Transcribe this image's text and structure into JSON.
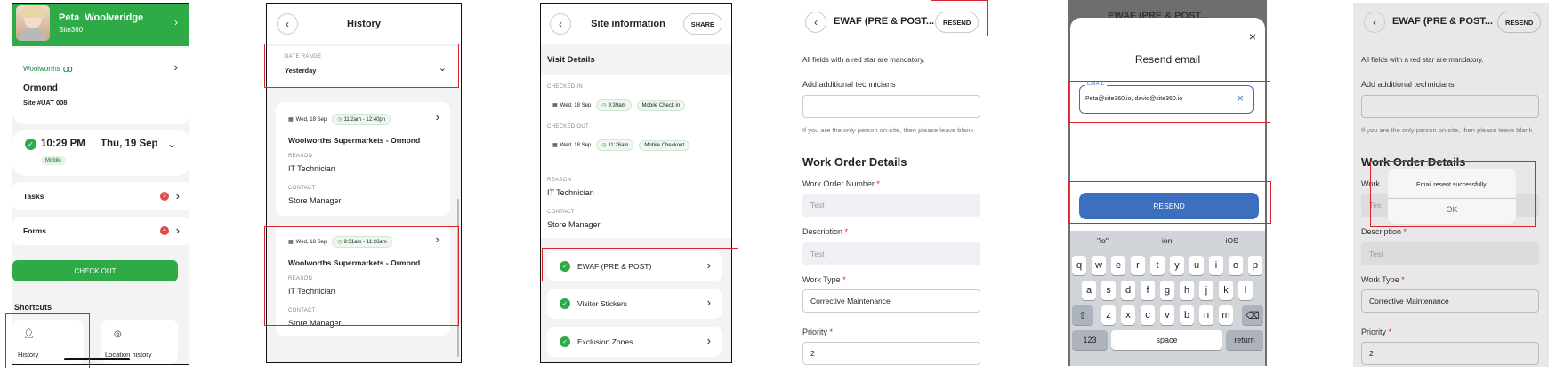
{
  "screen1": {
    "user_name": "Peta  Woolveridge",
    "user_company": "Site360",
    "store_brand": "Woolworths",
    "store_name": "Ormond",
    "store_id": "Site #UAT 008",
    "time": "10:29 PM",
    "date": "Thu, 19 Sep",
    "mode_badge": "Mobile",
    "tasks_label": "Tasks",
    "tasks_count": "3",
    "forms_label": "Forms",
    "forms_count": "4",
    "checkout_label": "CHECK OUT",
    "shortcuts_label": "Shortcuts",
    "history_label": "History",
    "location_history_label": "Location history"
  },
  "screen2": {
    "title": "History",
    "date_range_label": "DATE RANGE",
    "date_range_value": "Yesterday",
    "visits": [
      {
        "date": "Wed, 18 Sep",
        "time": "11:2am - 12:40pn",
        "site": "Woolworths Supermarkets - Ormond",
        "reason_label": "REASON",
        "reason": "IT Technician",
        "contact_label": "CONTACT",
        "contact": "Store Manager"
      },
      {
        "date": "Wed, 18 Sep",
        "time": "9:31am - 11:26am",
        "site": "Woolworths Supermarkets - Ormond",
        "reason_label": "REASON",
        "reason": "IT Technician",
        "contact_label": "CONTACT",
        "contact": "Store Manager"
      }
    ]
  },
  "screen3": {
    "title": "Site information",
    "share_label": "SHARE",
    "section_title": "Visit Details",
    "checked_in_label": "CHECKED IN",
    "checked_in_date": "Wed, 18 Sep",
    "checked_in_time": "9:39am",
    "checked_in_method": "Mobile Check in",
    "checked_out_label": "CHECKED OUT",
    "checked_out_date": "Wed, 18 Sep",
    "checked_out_time": "11:26am",
    "checked_out_method": "Mobile Checkout",
    "reason_label": "REASON",
    "reason": "IT Technician",
    "contact_label": "CONTACT",
    "contact": "Store Manager",
    "forms": [
      "EWAF (PRE & POST)",
      "Visitor Stickers",
      "Exclusion Zones"
    ]
  },
  "screen4": {
    "title": "EWAF (PRE & POST...",
    "resend_label": "RESEND",
    "mandatory_note": "All fields with a red star are mandatory.",
    "add_tech_label": "Add additional technicians",
    "add_tech_hint": "If you are the only person on-site, then please leave blank",
    "section_title": "Work Order Details",
    "won_label": "Work Order Number",
    "won_value": "Test",
    "desc_label": "Description",
    "desc_value": "Test",
    "worktype_label": "Work Type",
    "worktype_value": "Corrective Maintenance",
    "priority_label": "Priority",
    "priority_value": "2",
    "star": "*"
  },
  "screen5": {
    "header_ghost": "EWAF (PRE & POST...",
    "modal_title": "Resend email",
    "email_label": "EMAIL",
    "email_value": "Peta@site360.io, david@site360.io",
    "resend_button": "RESEND",
    "suggestions": [
      "\"io\"",
      "ion",
      "iOS"
    ],
    "row1": [
      "q",
      "w",
      "e",
      "r",
      "t",
      "y",
      "u",
      "i",
      "o",
      "p"
    ],
    "row2": [
      "a",
      "s",
      "d",
      "f",
      "g",
      "h",
      "j",
      "k",
      "l"
    ],
    "row3": [
      "z",
      "x",
      "c",
      "v",
      "b",
      "n",
      "m"
    ],
    "num_key": "123",
    "space_key": "space",
    "return_key": "return"
  },
  "screen6": {
    "title": "EWAF (PRE & POST...",
    "resend_label": "RESEND",
    "mandatory_note": "All fields with a red star are mandatory.",
    "add_tech_label": "Add additional technicians",
    "add_tech_hint": "If you are the only person on-site, then please leave blank",
    "section_title": "Work Order Details",
    "work_label_partial": "Work",
    "desc_label": "Description",
    "desc_value": "Test",
    "worktype_label": "Work Type",
    "worktype_value": "Corrective Maintenance",
    "priority_label": "Priority",
    "priority_value": "2",
    "alert_message": "Email resent successfully.",
    "alert_ok": "OK",
    "star": "*",
    "ghost_test": "Tes"
  },
  "colors": {
    "brand_green": "#2eaa47",
    "highlight_red": "#d9232d",
    "resend_blue": "#3c6fbd",
    "woolworths_green": "#178841"
  }
}
